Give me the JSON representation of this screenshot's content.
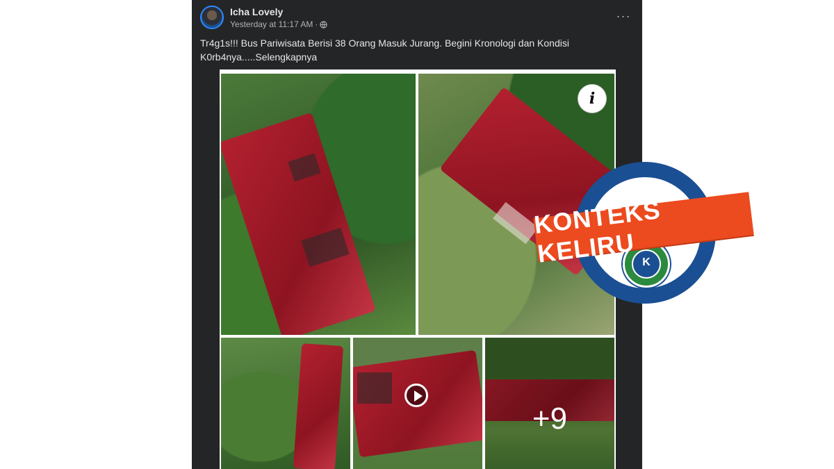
{
  "post": {
    "author": "Icha Lovely",
    "timestamp": "Yesterday at 11:17 AM",
    "separator": "·",
    "privacy_icon": "globe-icon",
    "more_icon": "more-options-icon",
    "more_glyph": "···",
    "caption": "Tr4g1s!!! Bus Pariwisata Berisi 38 Orang Masuk Jurang. Begini Kronologi dan Kondisi K0rb4nya.....Selengkapnya"
  },
  "media": {
    "info_glyph": "i",
    "play_icon": "play-icon",
    "more_count": "+9",
    "tiles": [
      {
        "name": "photo-1"
      },
      {
        "name": "photo-2"
      },
      {
        "name": "photo-3"
      },
      {
        "name": "video-4"
      },
      {
        "name": "photo-5-more"
      }
    ]
  },
  "stamp": {
    "label": "KONTEKS KELIRU",
    "banner_color": "#ec4a1f",
    "ring_color": "#1b4f93",
    "logo_color": "#2b8a3e",
    "logo_letter": "K"
  }
}
